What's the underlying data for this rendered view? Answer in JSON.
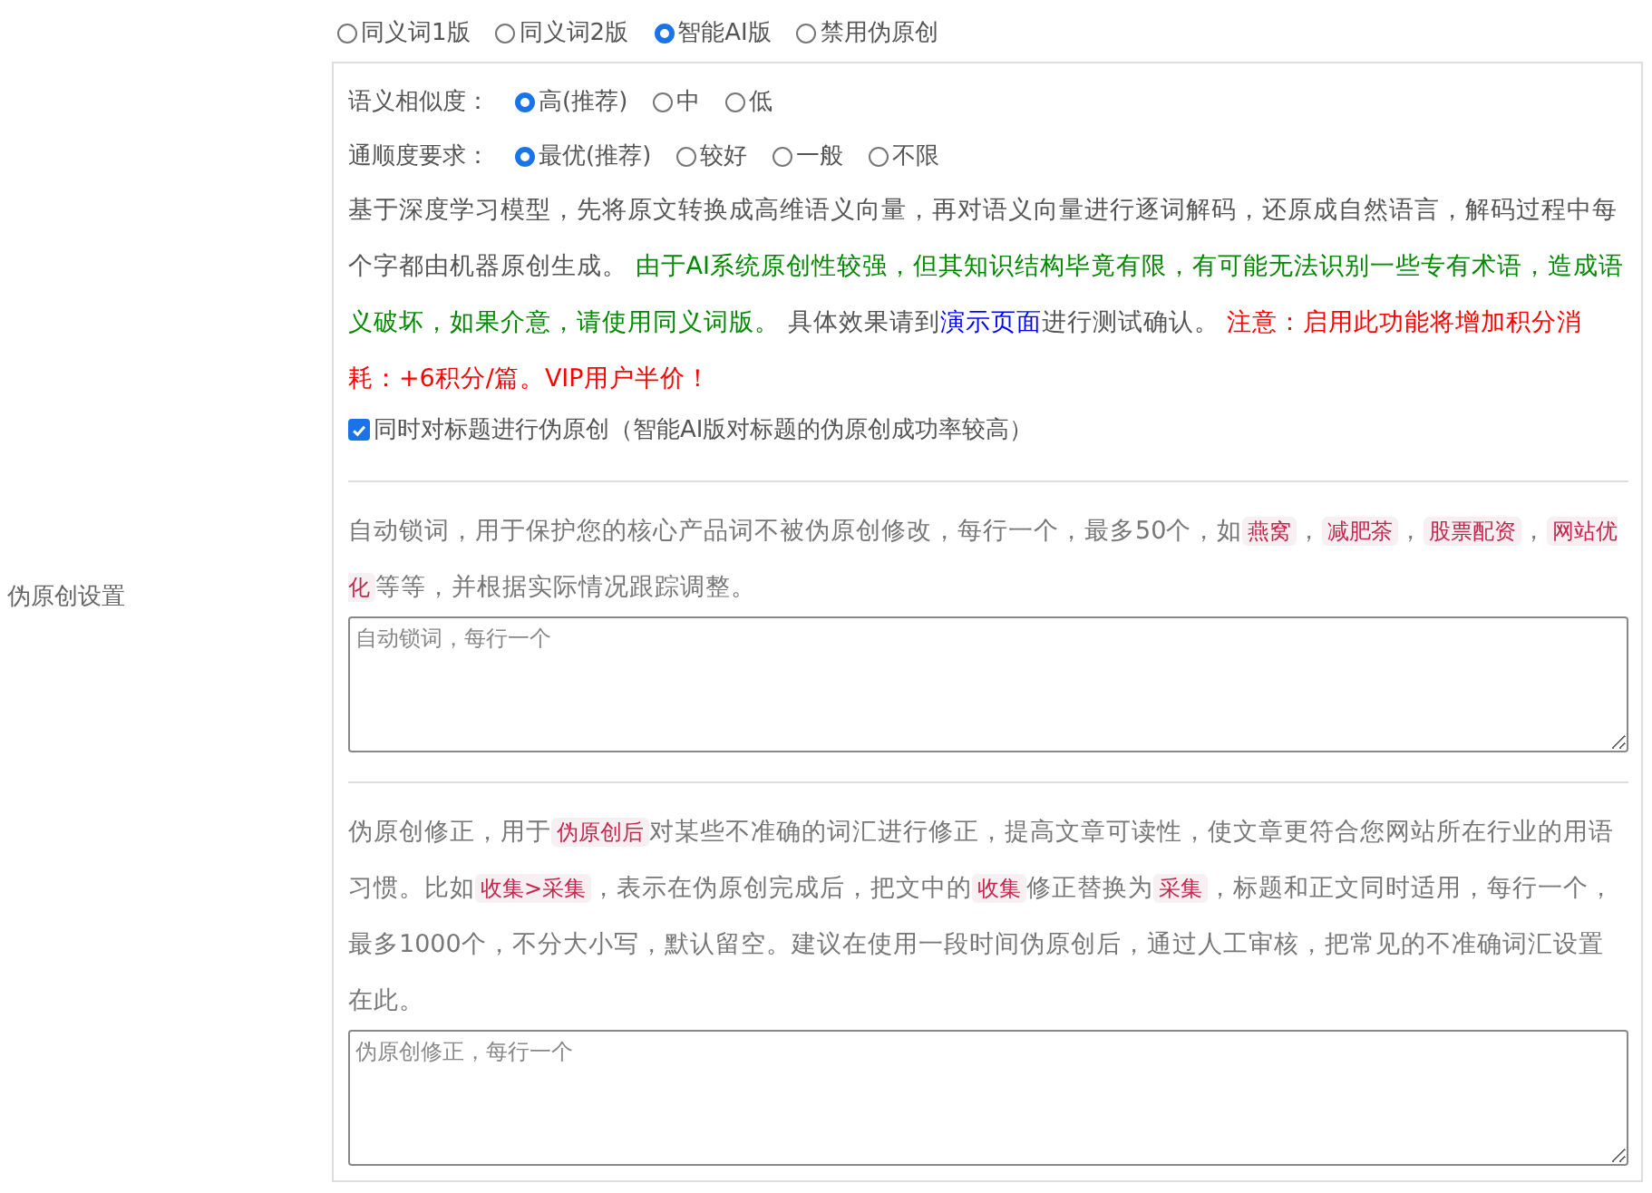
{
  "section_label": "伪原创设置",
  "modes": [
    {
      "label": "同义词1版",
      "selected": false
    },
    {
      "label": "同义词2版",
      "selected": false
    },
    {
      "label": "智能AI版",
      "selected": true
    },
    {
      "label": "禁用伪原创",
      "selected": false
    }
  ],
  "options": [
    {
      "label": "语义相似度：",
      "choices": [
        {
          "label": "高(推荐)",
          "selected": true
        },
        {
          "label": "中",
          "selected": false
        },
        {
          "label": "低",
          "selected": false
        }
      ]
    },
    {
      "label": "通顺度要求：",
      "choices": [
        {
          "label": "最优(推荐)",
          "selected": true
        },
        {
          "label": "较好",
          "selected": false
        },
        {
          "label": "一般",
          "selected": false
        },
        {
          "label": "不限",
          "selected": false
        }
      ]
    }
  ],
  "ai_description": [
    {
      "kind": "plain",
      "text": "基于深度学习模型，先将原文转换成高维语义向量，再对语义向量进行逐词解码，还原成自然语言，解码过程中每个字都由机器原创生成。 "
    },
    {
      "kind": "green",
      "text": "由于AI系统原创性较强，但其知识结构毕竟有限，有可能无法识别一些专有术语，造成语义破坏，如果介意，请使用同义词版。"
    },
    {
      "kind": "plain",
      "text": " 具体效果请到"
    },
    {
      "kind": "link",
      "text": "演示页面"
    },
    {
      "kind": "plain",
      "text": "进行测试确认。 "
    },
    {
      "kind": "red",
      "text": "注意：启用此功能将增加积分消耗：+6积分/篇。VIP用户半价！"
    }
  ],
  "title_option": {
    "label": "同时对标题进行伪原创（智能AI版对标题的伪原创成功率较高）",
    "checked": true
  },
  "lock_description": [
    {
      "kind": "plain",
      "text": "自动锁词，用于保护您的核心产品词不被伪原创修改，每行一个，最多50个，如"
    },
    {
      "kind": "code",
      "text": "燕窝"
    },
    {
      "kind": "plain",
      "text": "，"
    },
    {
      "kind": "code",
      "text": "减肥茶"
    },
    {
      "kind": "plain",
      "text": "，"
    },
    {
      "kind": "code",
      "text": "股票配资"
    },
    {
      "kind": "plain",
      "text": "，"
    },
    {
      "kind": "code",
      "text": "网站优化"
    },
    {
      "kind": "plain",
      "text": "等等，并根据实际情况跟踪调整。"
    }
  ],
  "lock_field": {
    "placeholder": "自动锁词，每行一个"
  },
  "correction_description": [
    {
      "kind": "plain",
      "text": "伪原创修正，用于"
    },
    {
      "kind": "code",
      "text": "伪原创后"
    },
    {
      "kind": "plain",
      "text": "对某些不准确的词汇进行修正，提高文章可读性，使文章更符合您网站所在行业的用语习惯。比如"
    },
    {
      "kind": "code",
      "text": "收集>采集"
    },
    {
      "kind": "plain",
      "text": "，表示在伪原创完成后，把文中的"
    },
    {
      "kind": "code",
      "text": "收集"
    },
    {
      "kind": "plain",
      "text": "修正替换为"
    },
    {
      "kind": "code",
      "text": "采集"
    },
    {
      "kind": "plain",
      "text": "，标题和正文同时适用，每行一个，最多1000个，不分大小写，默认留空。建议在使用一段时间伪原创后，通过人工审核，把常见的不准确词汇设置在此。"
    }
  ],
  "correction_field": {
    "placeholder": "伪原创修正，每行一个"
  }
}
